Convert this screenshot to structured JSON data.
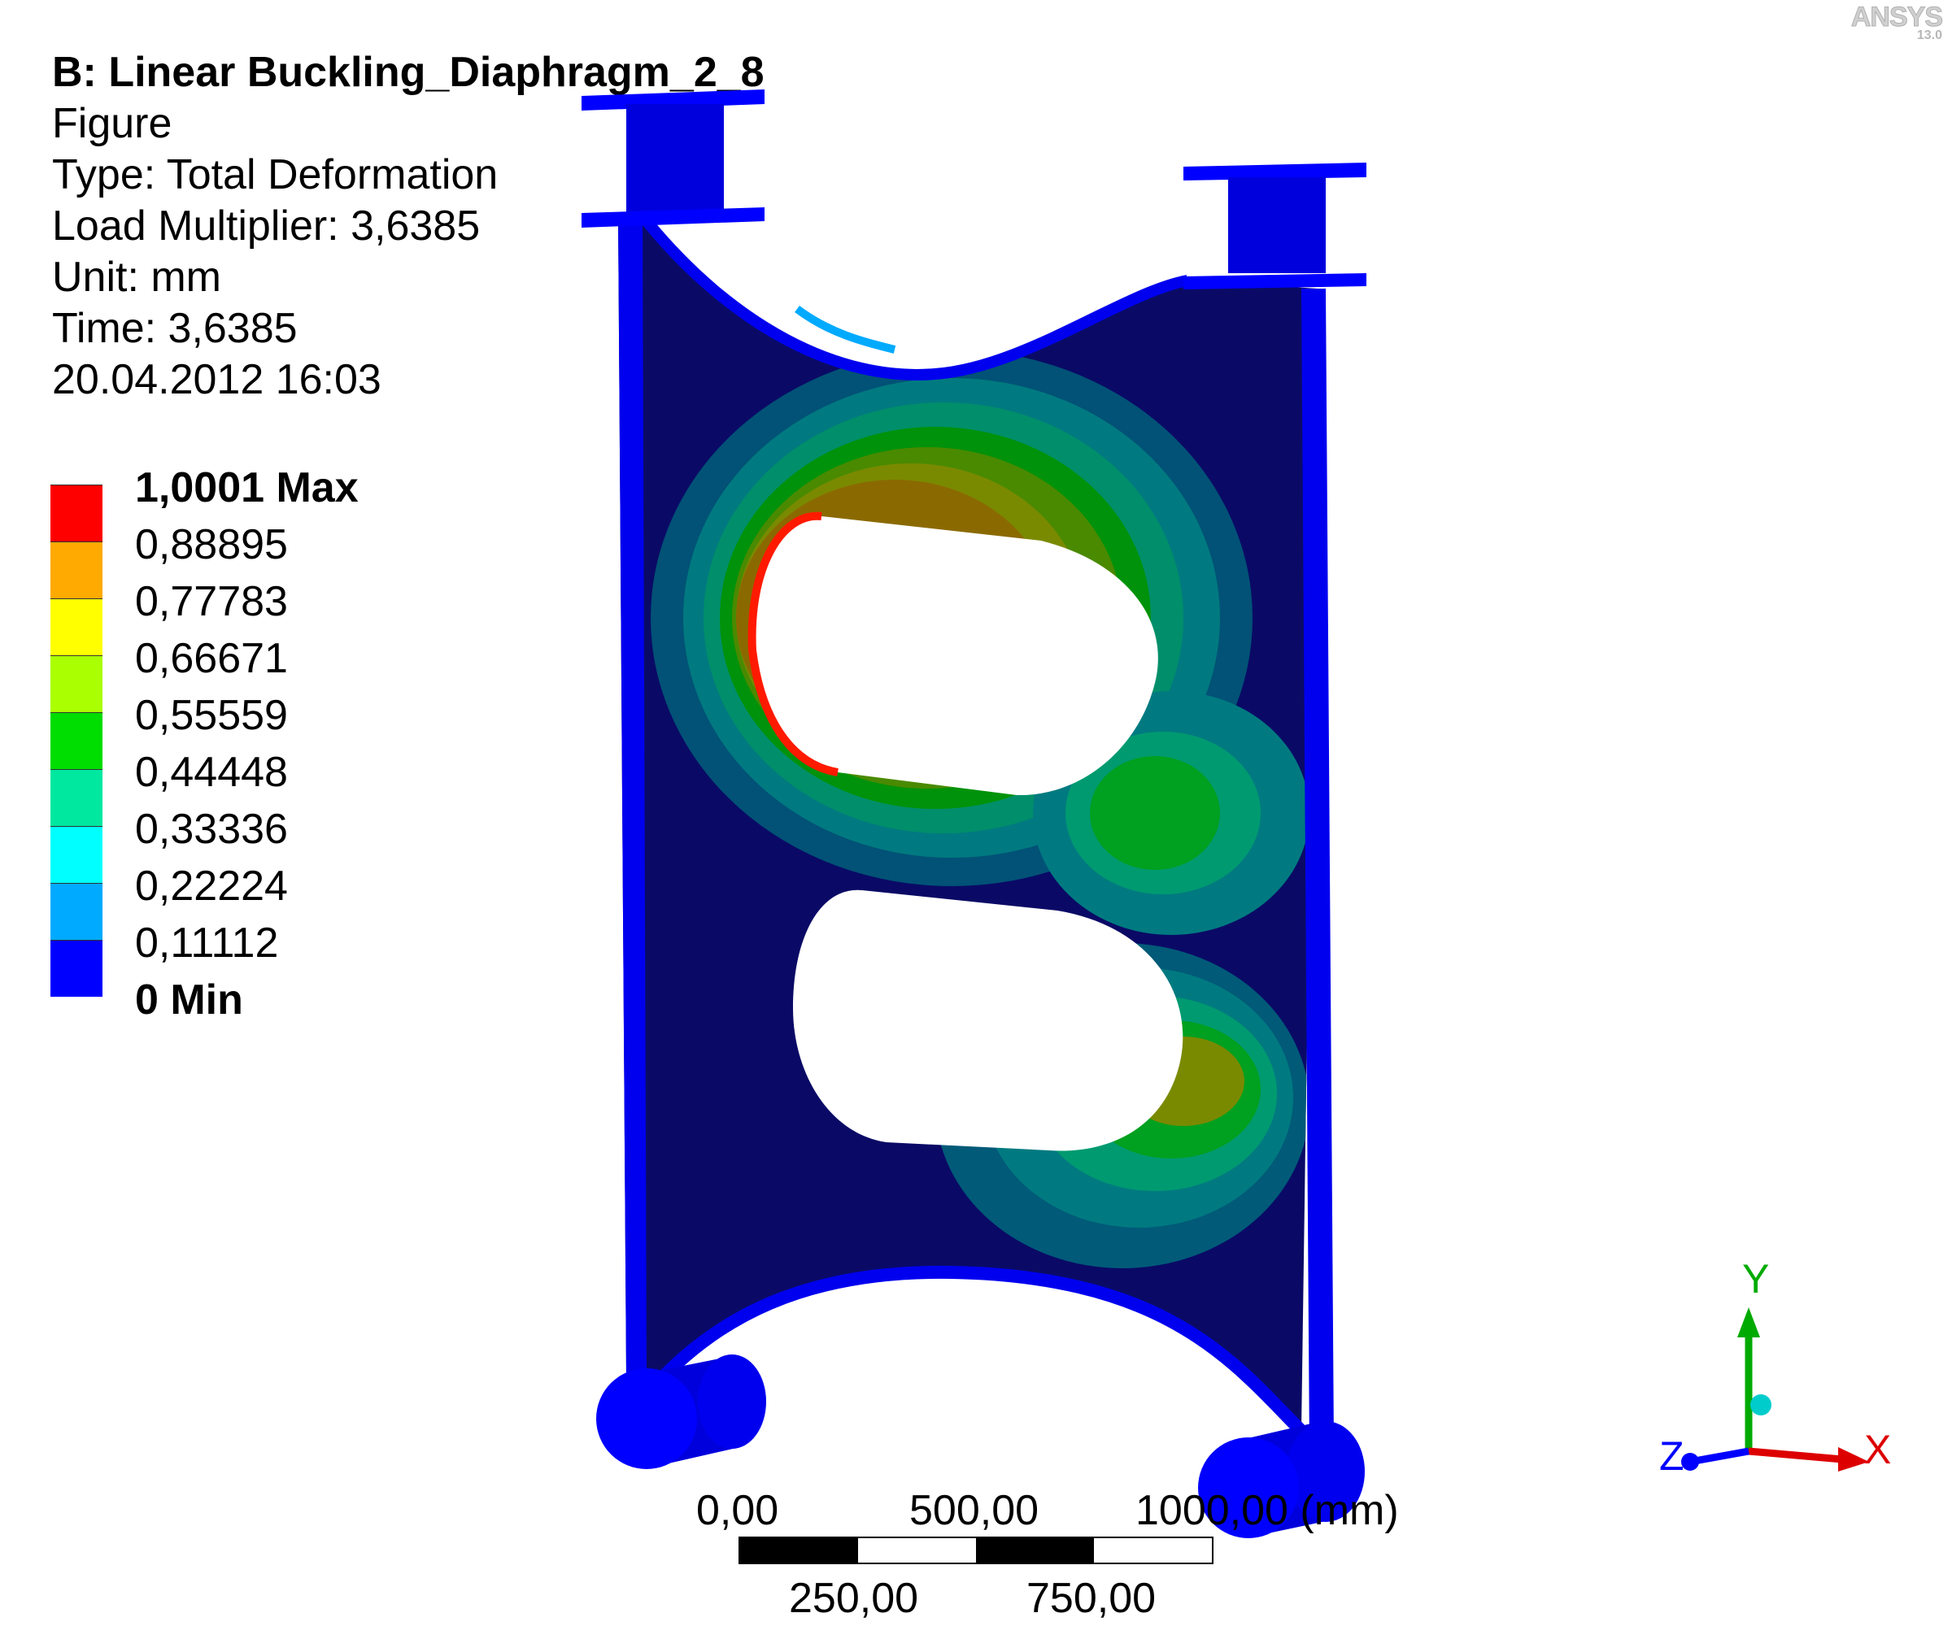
{
  "header": {
    "title": "B: Linear Buckling_Diaphragm_2_8",
    "object": "Figure",
    "type": "Type: Total Deformation",
    "load_multiplier": "Load Multiplier: 3,6385",
    "unit": "Unit: mm",
    "time": "Time: 3,6385",
    "date": "20.04.2012 16:03"
  },
  "legend": {
    "labels": [
      "1,0001 Max",
      "0,88895",
      "0,77783",
      "0,66671",
      "0,55559",
      "0,44448",
      "0,33336",
      "0,22224",
      "0,11112",
      "0 Min"
    ],
    "colors": [
      "#ff0000",
      "#ffaa00",
      "#ffff00",
      "#aaff00",
      "#00dd00",
      "#00e8a0",
      "#00ffff",
      "#00aaff",
      "#0000ff"
    ]
  },
  "logo": {
    "name": "ANSYS",
    "version": "13.0"
  },
  "scale_bar": {
    "top_labels": [
      "0,00",
      "500,00",
      "1000,00 (mm)"
    ],
    "bottom_labels": [
      "250,00",
      "750,00"
    ]
  },
  "triad": {
    "x": "X",
    "y": "Y",
    "z": "Z"
  }
}
